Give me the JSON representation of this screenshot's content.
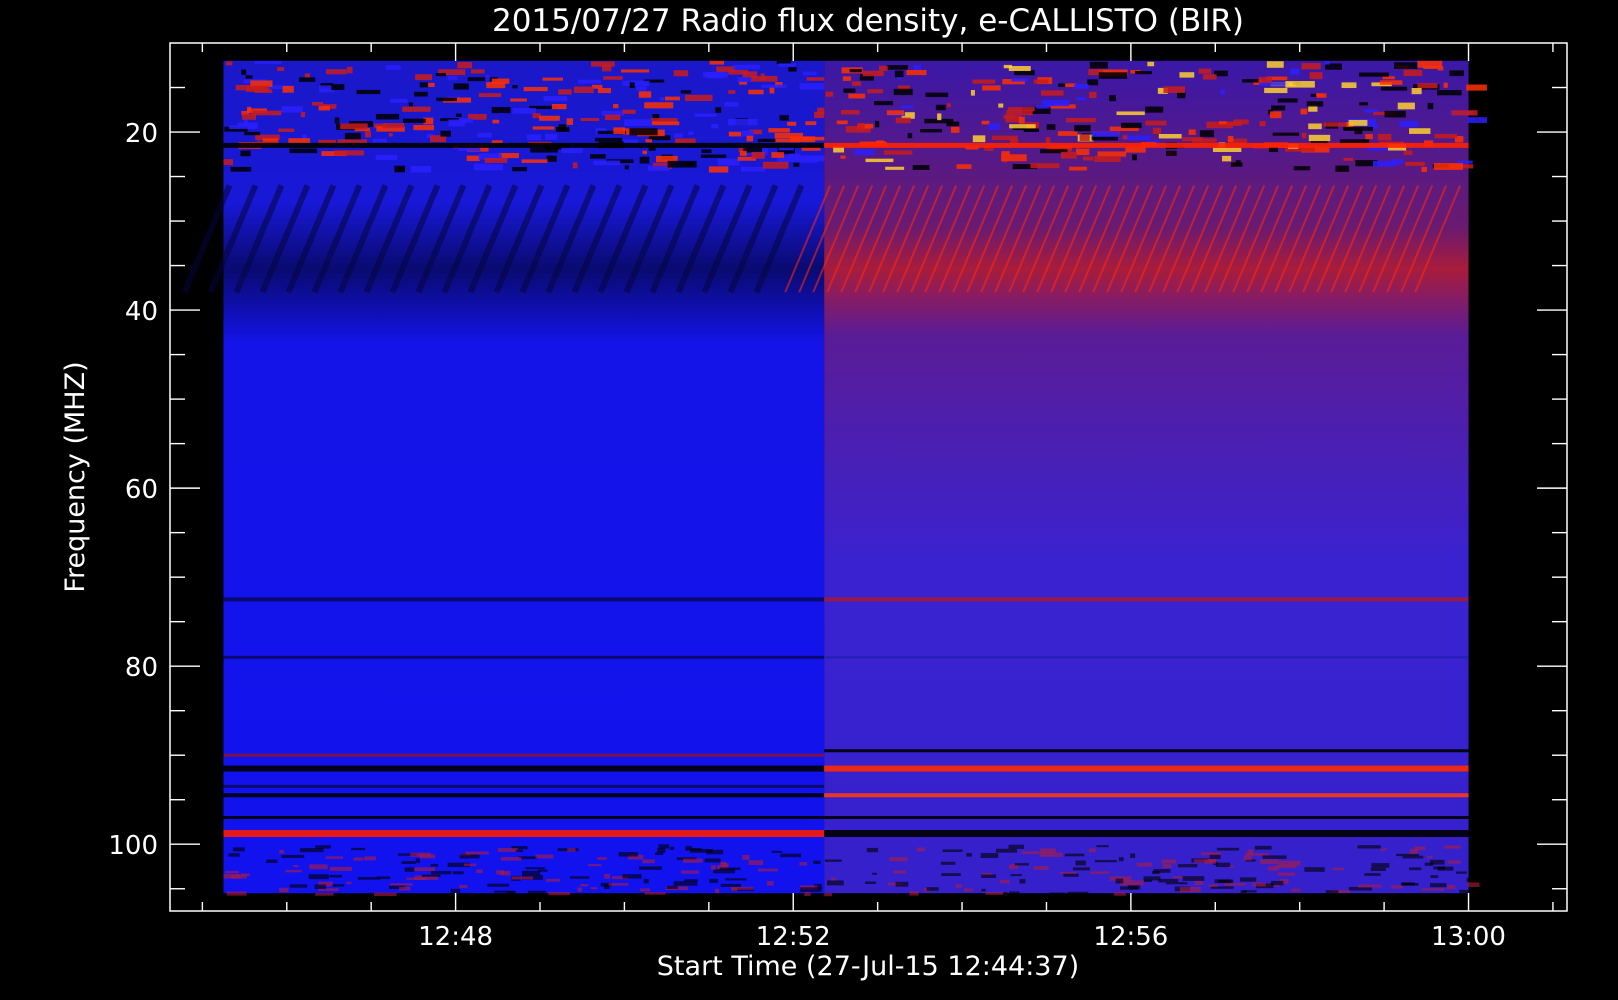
{
  "chart_data": {
    "type": "heatmap",
    "title": "2015/07/27  Radio flux density, e-CALLISTO (BIR)",
    "xlabel": "Start Time (27-Jul-15 12:44:37)",
    "ylabel": "Frequency (MHZ)",
    "x_ticks": [
      "12:48",
      "12:52",
      "12:56",
      "13:00"
    ],
    "y_ticks": [
      "20",
      "40",
      "60",
      "80",
      "100"
    ],
    "x_range_minutes": [
      0,
      16.55
    ],
    "y_range_mhz": [
      10,
      107.5
    ],
    "data_time_range": [
      "12:45:15",
      "13:00:00"
    ],
    "data_freq_range_mhz": [
      12,
      105.5
    ],
    "segments": [
      {
        "start": "12:45:15",
        "end": "12:52:22",
        "background": "blue"
      },
      {
        "start": "12:52:22",
        "end": "13:00:00",
        "background": "purple"
      }
    ],
    "colors": {
      "background": "#000000",
      "axes": "#ffffff",
      "low": "#1010ee",
      "mid": "#3a20c8",
      "high": "#ff2000",
      "peak": "#ffe040"
    }
  }
}
